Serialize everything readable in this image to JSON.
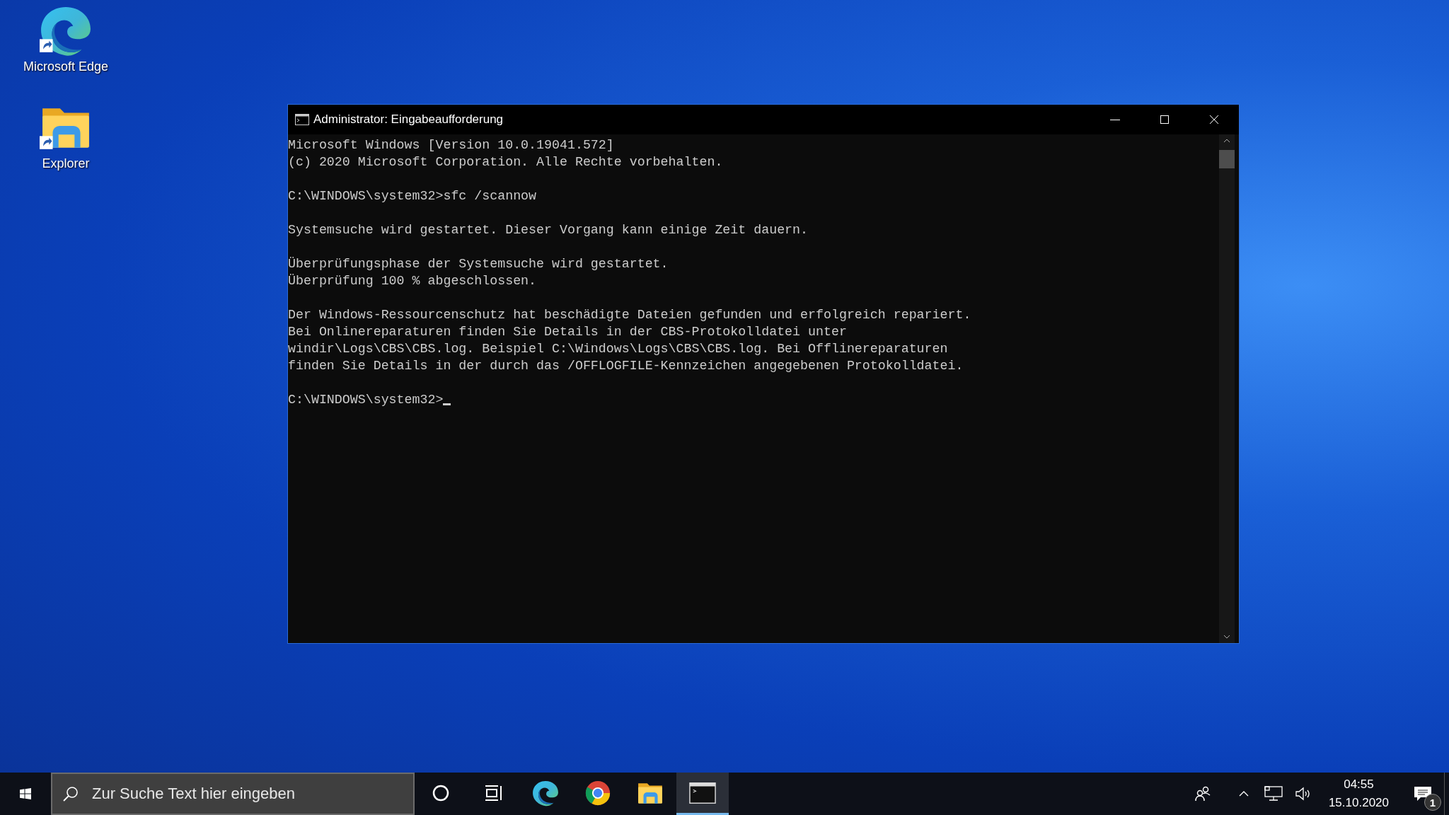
{
  "desktop_icons": [
    {
      "kind": "edge",
      "label": "Microsoft Edge"
    },
    {
      "kind": "folder",
      "label": "Explorer"
    }
  ],
  "window": {
    "title": "Administrator: Eingabeaufforderung",
    "blocks": [
      [
        "Microsoft Windows [Version 10.0.19041.572]",
        "(c) 2020 Microsoft Corporation. Alle Rechte vorbehalten."
      ],
      [
        "C:\\WINDOWS\\system32>sfc /scannow"
      ],
      [
        "Systemsuche wird gestartet. Dieser Vorgang kann einige Zeit dauern."
      ],
      [
        "Überprüfungsphase der Systemsuche wird gestartet.",
        "Überprüfung 100 % abgeschlossen."
      ],
      [
        "Der Windows-Ressourcenschutz hat beschädigte Dateien gefunden und erfolgreich repariert.",
        "Bei Onlinereparaturen finden Sie Details in der CBS-Protokolldatei unter",
        "windir\\Logs\\CBS\\CBS.log. Beispiel C:\\Windows\\Logs\\CBS\\CBS.log. Bei Offlinereparaturen",
        "finden Sie Details in der durch das /OFFLOGFILE-Kennzeichen angegebenen Protokolldatei."
      ]
    ],
    "prompt": "C:\\WINDOWS\\system32>"
  },
  "taskbar": {
    "search": {
      "placeholder": "Zur Suche Text hier eingeben"
    },
    "apps": [
      {
        "kind": "cortana",
        "selected": false
      },
      {
        "kind": "taskview",
        "selected": false
      },
      {
        "kind": "edge",
        "selected": false
      },
      {
        "kind": "chrome",
        "selected": false
      },
      {
        "kind": "folder",
        "selected": false
      },
      {
        "kind": "cmd",
        "selected": true
      }
    ],
    "clock": {
      "time": "04:55",
      "date": "15.10.2020"
    },
    "notifications": {
      "badge": "1"
    }
  }
}
